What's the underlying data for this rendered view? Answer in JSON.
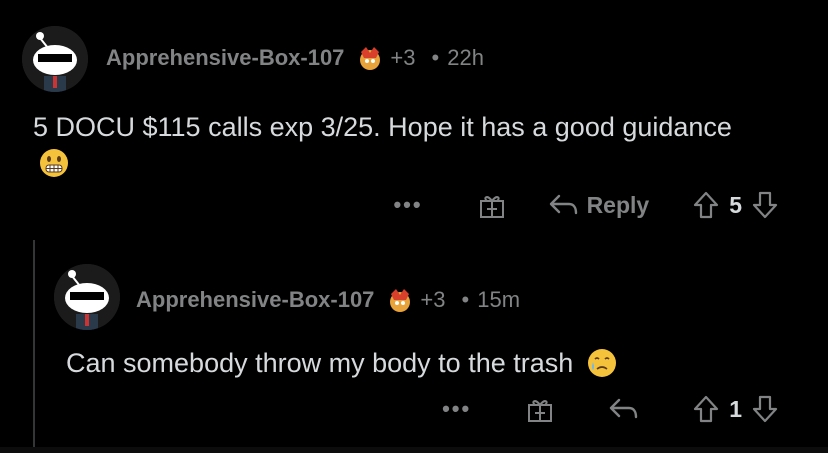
{
  "comments": [
    {
      "username": "Apprehensive-Box-107",
      "karma": "+3",
      "separator": "•",
      "time": "22h",
      "text": "5 DOCU $115 calls exp 3/25. Hope it has a good guidance",
      "emoji": "grimacing-face-icon",
      "actions": {
        "more": "•••",
        "reply": "Reply",
        "votes": "5"
      }
    },
    {
      "username": "Apprehensive-Box-107",
      "karma": "+3",
      "separator": "•",
      "time": "15m",
      "text": "Can somebody throw my body to the trash",
      "emoji": "face-holding-back-tears-icon",
      "actions": {
        "more": "•••",
        "votes": "1"
      }
    }
  ],
  "colors": {
    "background": "#000000",
    "text": "#d7dadc",
    "meta": "#818384",
    "thread_line": "#343536"
  }
}
